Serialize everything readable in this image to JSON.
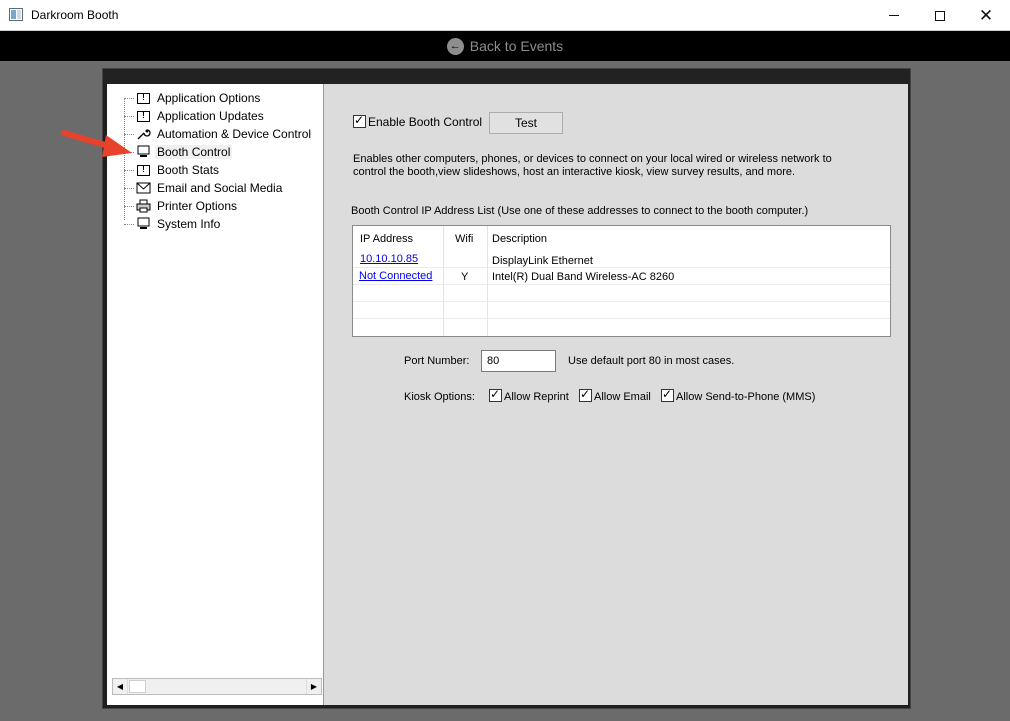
{
  "window": {
    "title": "Darkroom Booth"
  },
  "header": {
    "back_label": "Back to Events"
  },
  "tree": {
    "items": [
      {
        "label": "Application Options",
        "icon": "document-icon"
      },
      {
        "label": "Application Updates",
        "icon": "document-icon"
      },
      {
        "label": "Automation & Device Control",
        "icon": "wrench-icon"
      },
      {
        "label": "Booth Control",
        "icon": "computer-icon",
        "selected": true
      },
      {
        "label": "Booth Stats",
        "icon": "document-icon"
      },
      {
        "label": "Email and Social Media",
        "icon": "envelope-icon"
      },
      {
        "label": "Printer Options",
        "icon": "printer-icon"
      },
      {
        "label": "System Info",
        "icon": "computer-icon"
      }
    ]
  },
  "booth_control": {
    "enable_label": "Enable Booth Control",
    "enable_checked": true,
    "test_label": "Test",
    "description_line1": "Enables other computers, phones, or devices to connect on your local wired or wireless network to",
    "description_line2": "control the booth,view slideshows, host an interactive kiosk, view survey results, and more.",
    "list_title": "Booth Control IP Address List  (Use one of these addresses to connect to the booth computer.)",
    "columns": [
      "IP Address",
      "Wifi",
      "Description"
    ],
    "rows": [
      {
        "ip": "10.10.10.85",
        "wifi": "",
        "description": "DisplayLink Ethernet"
      },
      {
        "ip": "Not Connected",
        "wifi": "Y",
        "description": "Intel(R) Dual Band Wireless-AC 8260"
      }
    ],
    "port_label": "Port Number:",
    "port_value": "80",
    "port_hint": "Use default port 80 in most cases.",
    "kiosk_label": "Kiosk Options:",
    "kiosk_options": [
      {
        "label": "Allow Reprint",
        "checked": true
      },
      {
        "label": "Allow Email",
        "checked": true
      },
      {
        "label": "Allow Send-to-Phone (MMS)",
        "checked": true
      }
    ]
  },
  "colors": {
    "accent_arrow": "#e8412c",
    "link": "#0000ee"
  }
}
